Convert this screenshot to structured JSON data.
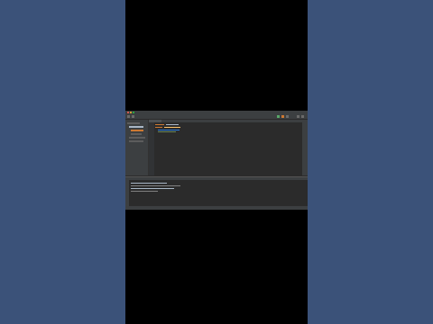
{
  "colors": {
    "background": "#3b5279",
    "ide_bg": "#2b2b2b",
    "panel_bg": "#3c3f41",
    "keyword": "#cc7832",
    "string": "#6a8759",
    "function": "#ffc66d",
    "link": "#287bde"
  },
  "ide": {
    "title": "",
    "status_text": ""
  }
}
